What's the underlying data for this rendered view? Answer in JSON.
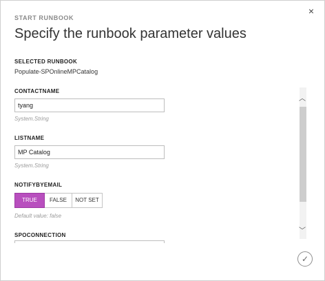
{
  "header": {
    "eyebrow": "START RUNBOOK",
    "title": "Specify the runbook parameter values",
    "close_icon": "×"
  },
  "selected_runbook": {
    "label": "SELECTED RUNBOOK",
    "value": "Populate-SPOnlineMPCatalog"
  },
  "fields": {
    "contactname": {
      "label": "CONTACTNAME",
      "value": "tyang",
      "type_hint": "System.String"
    },
    "listname": {
      "label": "LISTNAME",
      "value": "MP Catalog",
      "type_hint": "System.String"
    },
    "notifybyemail": {
      "label": "NOTIFYBYEMAIL",
      "options": [
        "TRUE",
        "FALSE",
        "NOT SET"
      ],
      "selected": "TRUE",
      "default_hint": "Default value: false"
    },
    "spoconnection": {
      "label": "SPOCONNECTION"
    }
  },
  "scrollbar": {
    "up_icon": "︿",
    "down_icon": "﹀"
  },
  "footer": {
    "ok_icon": "✓"
  },
  "colors": {
    "accent": "#b84fbe",
    "border": "#bdbdbd",
    "hint": "#9a9a9a"
  },
  "icons": [
    "close-icon",
    "chevron-up-icon",
    "chevron-down-icon",
    "checkmark-icon"
  ]
}
